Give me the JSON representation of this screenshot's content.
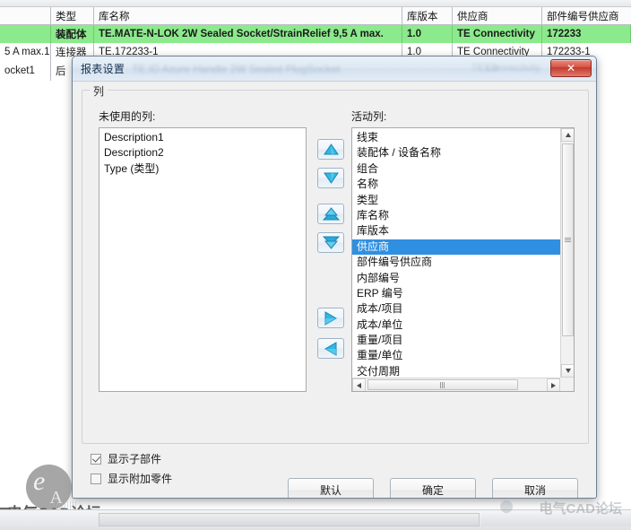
{
  "background_table": {
    "headers": [
      "",
      "类型",
      "库名称",
      "库版本",
      "供应商",
      "部件编号供应商"
    ],
    "rows": [
      [
        "",
        "装配体",
        "TE.MATE-N-LOK 2W Sealed Socket/StrainRelief 9,5 A max.",
        "1.0",
        "TE Connectivity",
        "172233"
      ],
      [
        "5 A max.1",
        "连接器",
        "TE.172233-1",
        "1.0",
        "TE Connectivity",
        "172233-1"
      ],
      [
        "ocket1",
        "后",
        "",
        "",
        "",
        ""
      ]
    ]
  },
  "dialog": {
    "title": "报表设置",
    "title_ghost": "TE.ID Azure Handle 2W Sealed PlugSocket",
    "title_ghost2": "1.0",
    "title_ghost3": "TE Connectivity",
    "close_label": "✕",
    "groupbox_title": "列",
    "unused_label": "未使用的列:",
    "active_label": "活动列:",
    "unused_columns": [
      "Description1",
      "Description2",
      "Type (类型)"
    ],
    "active_columns": [
      "线束",
      "装配体 / 设备名称",
      "组合",
      "名称",
      "类型",
      "库名称",
      "库版本",
      "供应商",
      "部件编号供应商",
      "内部编号",
      "ERP 编号",
      "成本/项目",
      "成本/单位",
      "重量/项目",
      "重量/单位",
      "交付周期"
    ],
    "active_selected_index": 7,
    "transfer_buttons": [
      {
        "name": "move-up",
        "glyph": "▲"
      },
      {
        "name": "move-down",
        "glyph": "▼"
      },
      {
        "name": "move-top",
        "glyph": "▲"
      },
      {
        "name": "move-bottom",
        "glyph": "▼"
      },
      {
        "name": "add-column",
        "glyph": "▶"
      },
      {
        "name": "remove-column",
        "glyph": "◀"
      }
    ],
    "checkboxes": [
      {
        "label": "显示子部件",
        "checked": true
      },
      {
        "label": "显示附加零件",
        "checked": false
      }
    ],
    "buttons": {
      "default": "默认",
      "ok": "确定",
      "cancel": "取消"
    }
  },
  "watermarks": {
    "left_text": "电气CAD论坛",
    "right_text": "电气CAD论坛",
    "logo_e": "e",
    "logo_a": "A"
  },
  "colors": {
    "selection": "#2f8fe0",
    "row_highlight": "#8bea8b",
    "close_button": "#c33b2d",
    "arrow_cyan": "#2fb8e8"
  }
}
